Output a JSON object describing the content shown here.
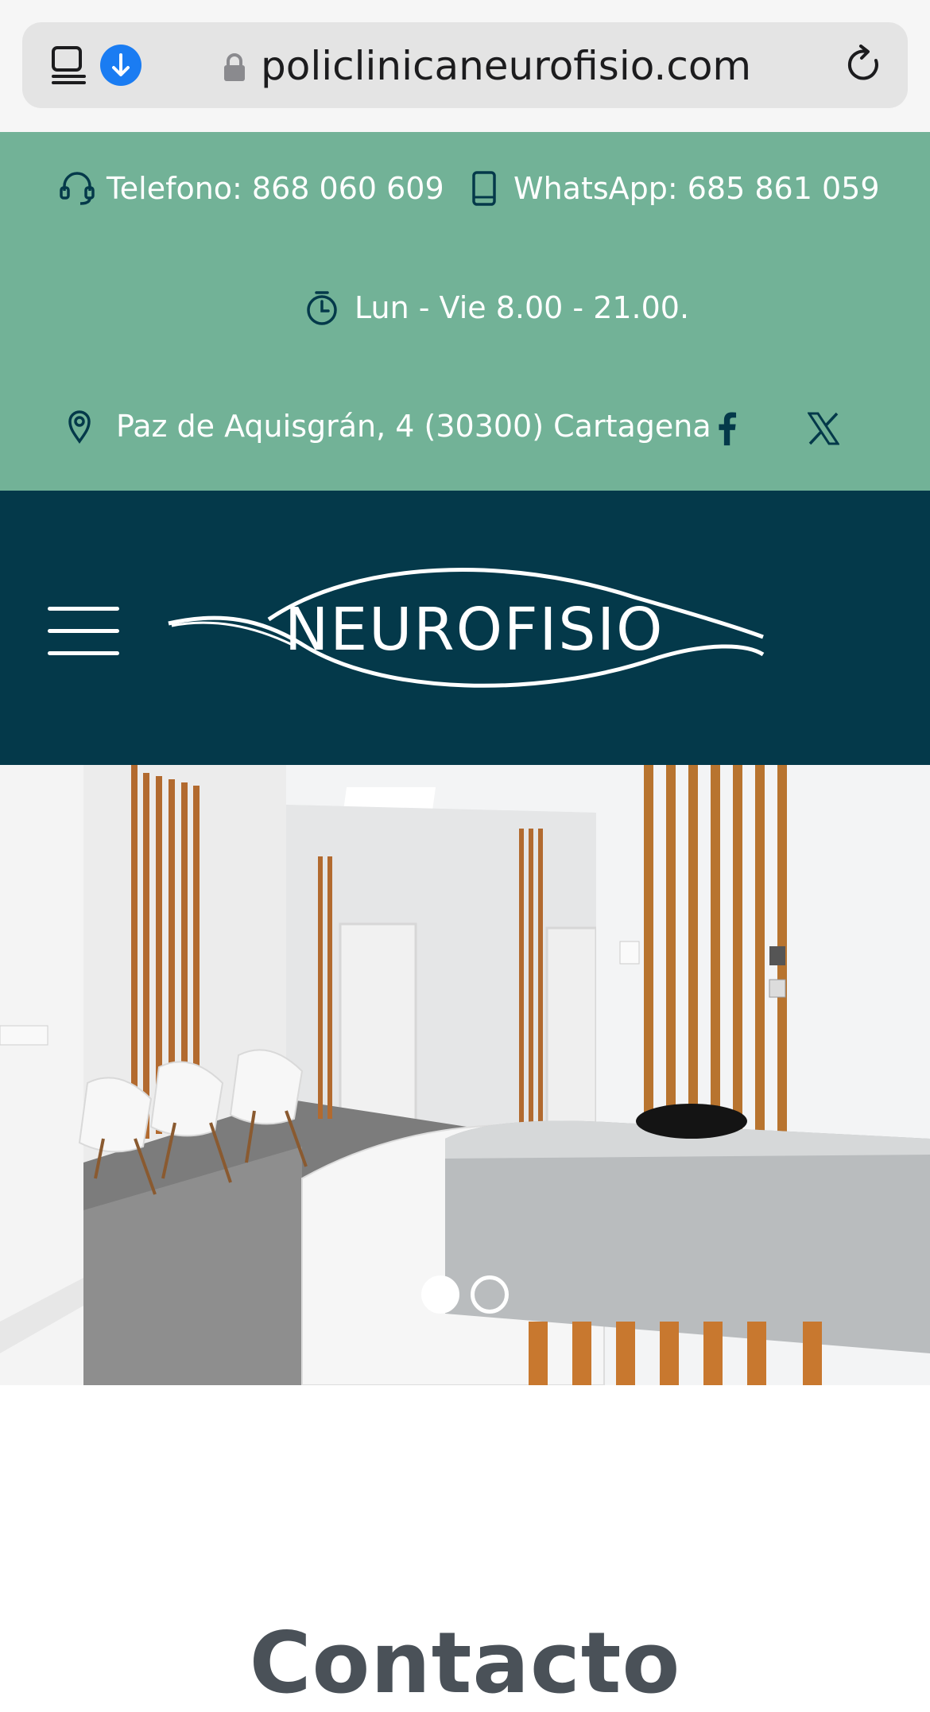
{
  "browser": {
    "url": "policlinicaneurofisio.com",
    "tab_icon": "tabs-icon",
    "download_icon": "download-icon",
    "lock_icon": "lock-icon",
    "reload_icon": "reload-icon",
    "accent": "#1a7cf2"
  },
  "topbar": {
    "phone": "Telefono: 868 060 609",
    "whatsapp": "WhatsApp: 685 861 059",
    "hours": "Lun - Vie 8.00 - 21.00.",
    "address": "Paz de Aquisgrán, 4 (30300) Cartagena",
    "facebook_icon": "facebook-icon",
    "x_icon": "x-twitter-icon",
    "bg_color": "#72b297"
  },
  "header": {
    "logo_text": "NEUROFISIO",
    "menu_icon": "hamburger-menu-icon",
    "bg_color": "#04394a"
  },
  "hero": {
    "slides": 2,
    "active_slide": 1
  },
  "contact": {
    "title": "Contacto"
  }
}
